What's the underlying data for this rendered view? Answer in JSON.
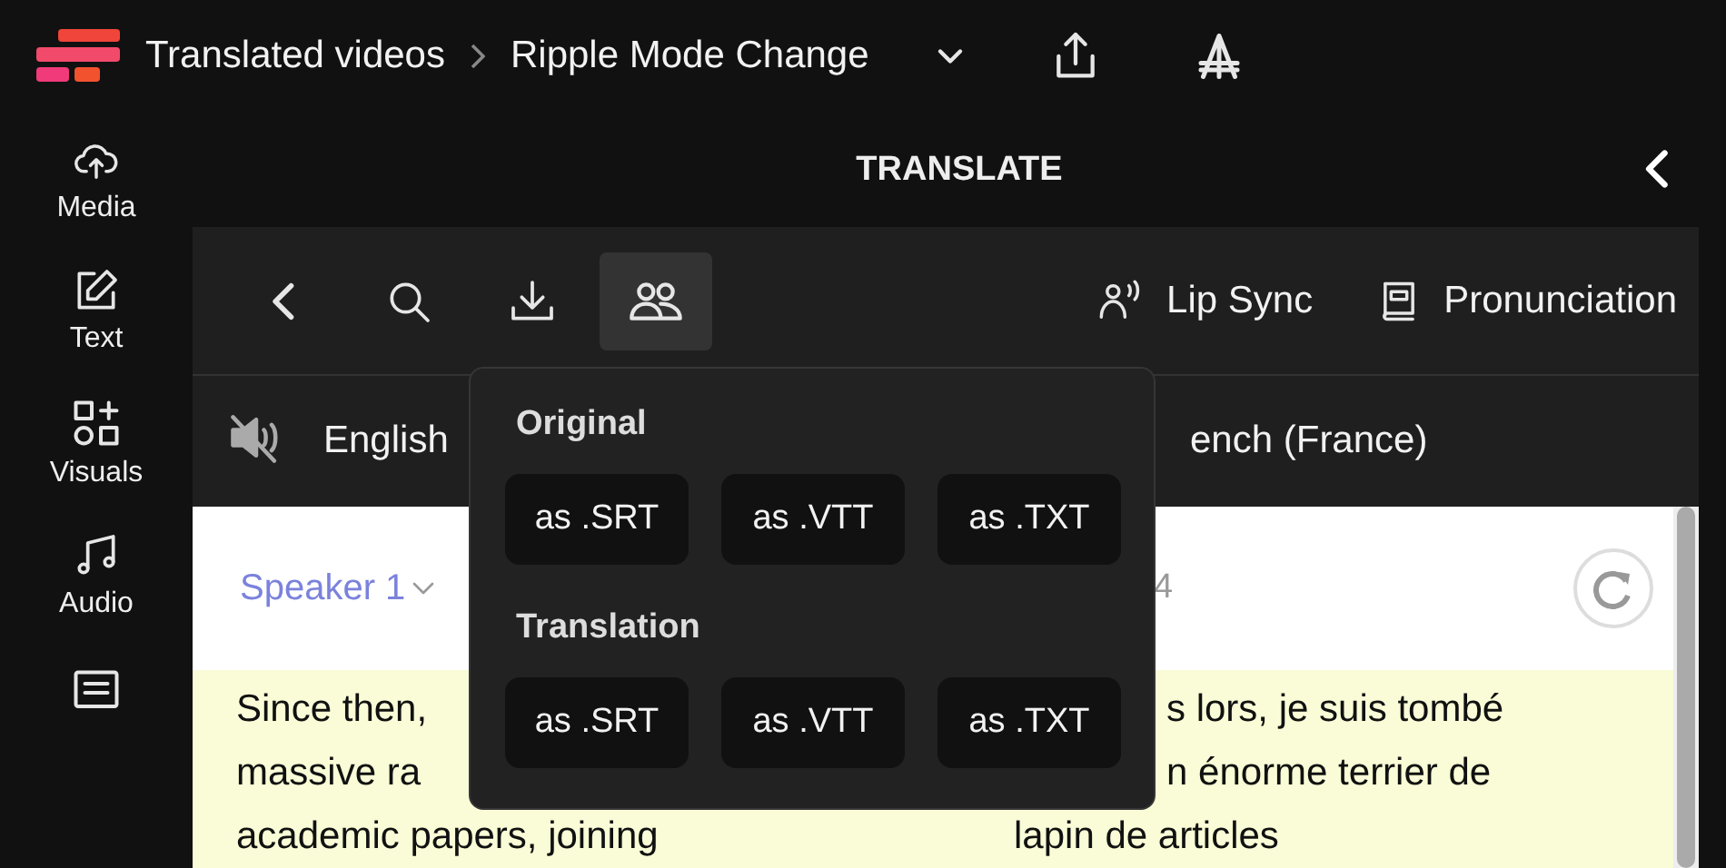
{
  "topbar": {
    "breadcrumb": [
      "Translated videos",
      "Ripple Mode Change"
    ]
  },
  "sidebar": {
    "items": [
      {
        "kind": "upload",
        "label": "Media"
      },
      {
        "kind": "text",
        "label": "Text"
      },
      {
        "kind": "visuals",
        "label": "Visuals"
      },
      {
        "kind": "audio",
        "label": "Audio"
      },
      {
        "kind": "subtitles"
      }
    ]
  },
  "panel": {
    "title": "TRANSLATE",
    "tools": [
      {
        "kind": "back",
        "selected": false
      },
      {
        "kind": "search",
        "selected": false
      },
      {
        "kind": "download",
        "selected": false
      },
      {
        "kind": "speakers",
        "selected": true
      }
    ],
    "actions": [
      {
        "kind": "lipsync",
        "label": "Lip Sync"
      },
      {
        "kind": "pronunciation",
        "label": "Pronunciation"
      }
    ],
    "source_language": {
      "label": "English",
      "muted": true
    },
    "target_language": {
      "label": "ench (France)"
    },
    "segment": {
      "speaker": "Speaker 1",
      "timestamp": "4",
      "source_lines": [
        "Since then,",
        "massive ra",
        "academic papers, joining"
      ],
      "target_lines": [
        "s lors, je suis tombé",
        "n énorme terrier de",
        "lapin de articles"
      ]
    }
  },
  "download_menu": {
    "groups": [
      {
        "title": "Original",
        "formats": [
          "as .SRT",
          "as .VTT",
          "as .TXT"
        ]
      },
      {
        "title": "Translation",
        "formats": [
          "as .SRT",
          "as .VTT",
          "as .TXT"
        ]
      }
    ]
  }
}
